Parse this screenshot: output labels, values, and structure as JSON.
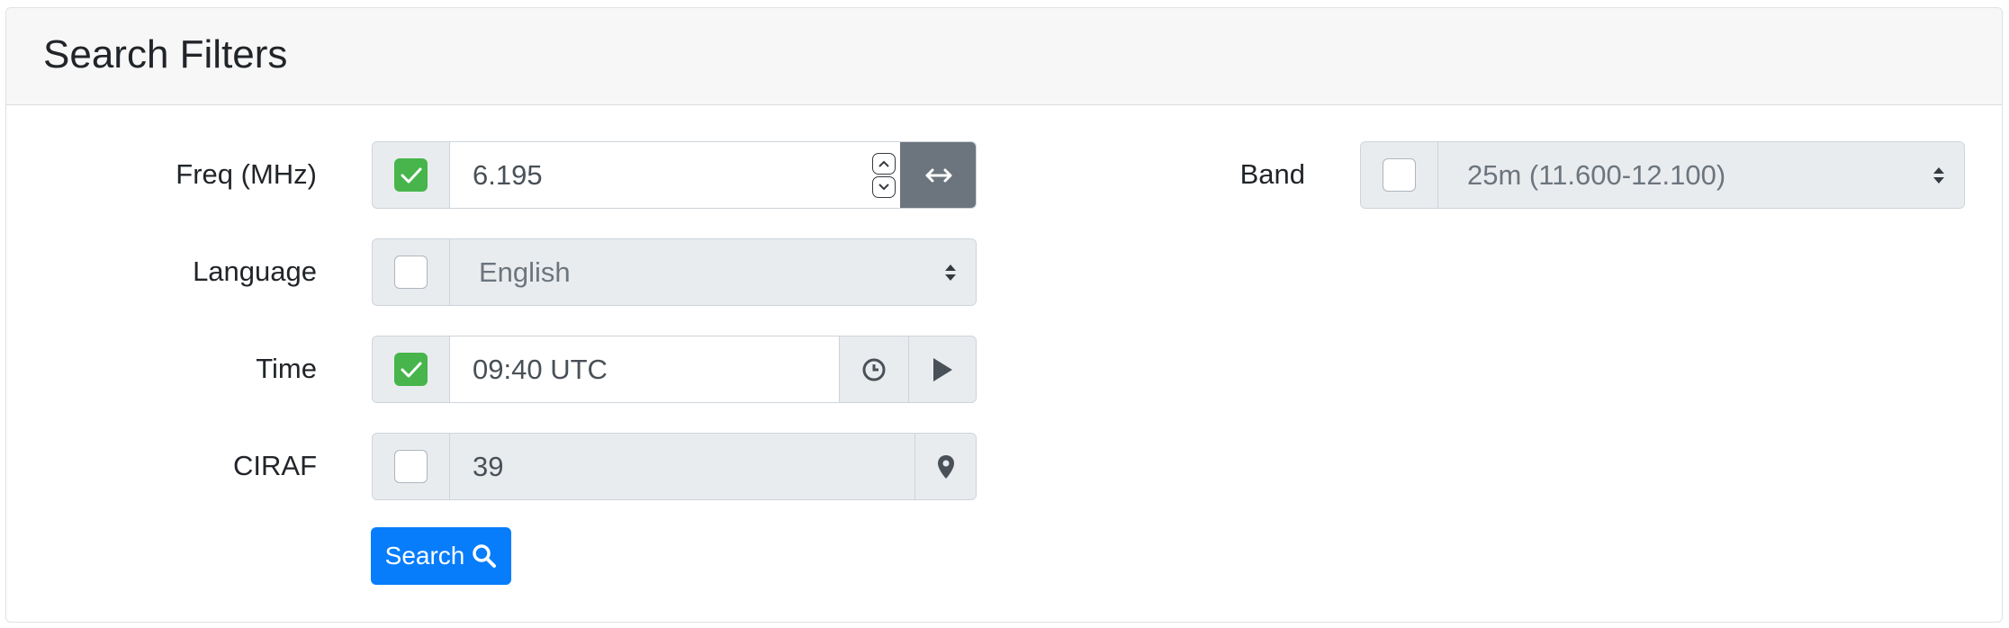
{
  "card": {
    "title": "Search Filters"
  },
  "filters": {
    "freq": {
      "label": "Freq (MHz)",
      "value": "6.195",
      "enabled": true
    },
    "language": {
      "label": "Language",
      "value": "English",
      "enabled": false
    },
    "time": {
      "label": "Time",
      "value": "09:40 UTC",
      "enabled": true
    },
    "ciraf": {
      "label": "CIRAF",
      "value": "39",
      "enabled": false
    },
    "band": {
      "label": "Band",
      "value": "25m (11.600-12.100)",
      "enabled": false
    }
  },
  "search_button": {
    "label": "Search"
  },
  "colors": {
    "checked": "#47b54b",
    "primary": "#087dfb",
    "addon_dark": "#6c757d"
  },
  "icons": [
    "checkmark-icon",
    "spinner-up-icon",
    "spinner-down-icon",
    "swap-arrows-icon",
    "select-arrows-icon",
    "clock-icon",
    "play-icon",
    "map-marker-icon",
    "search-icon"
  ]
}
